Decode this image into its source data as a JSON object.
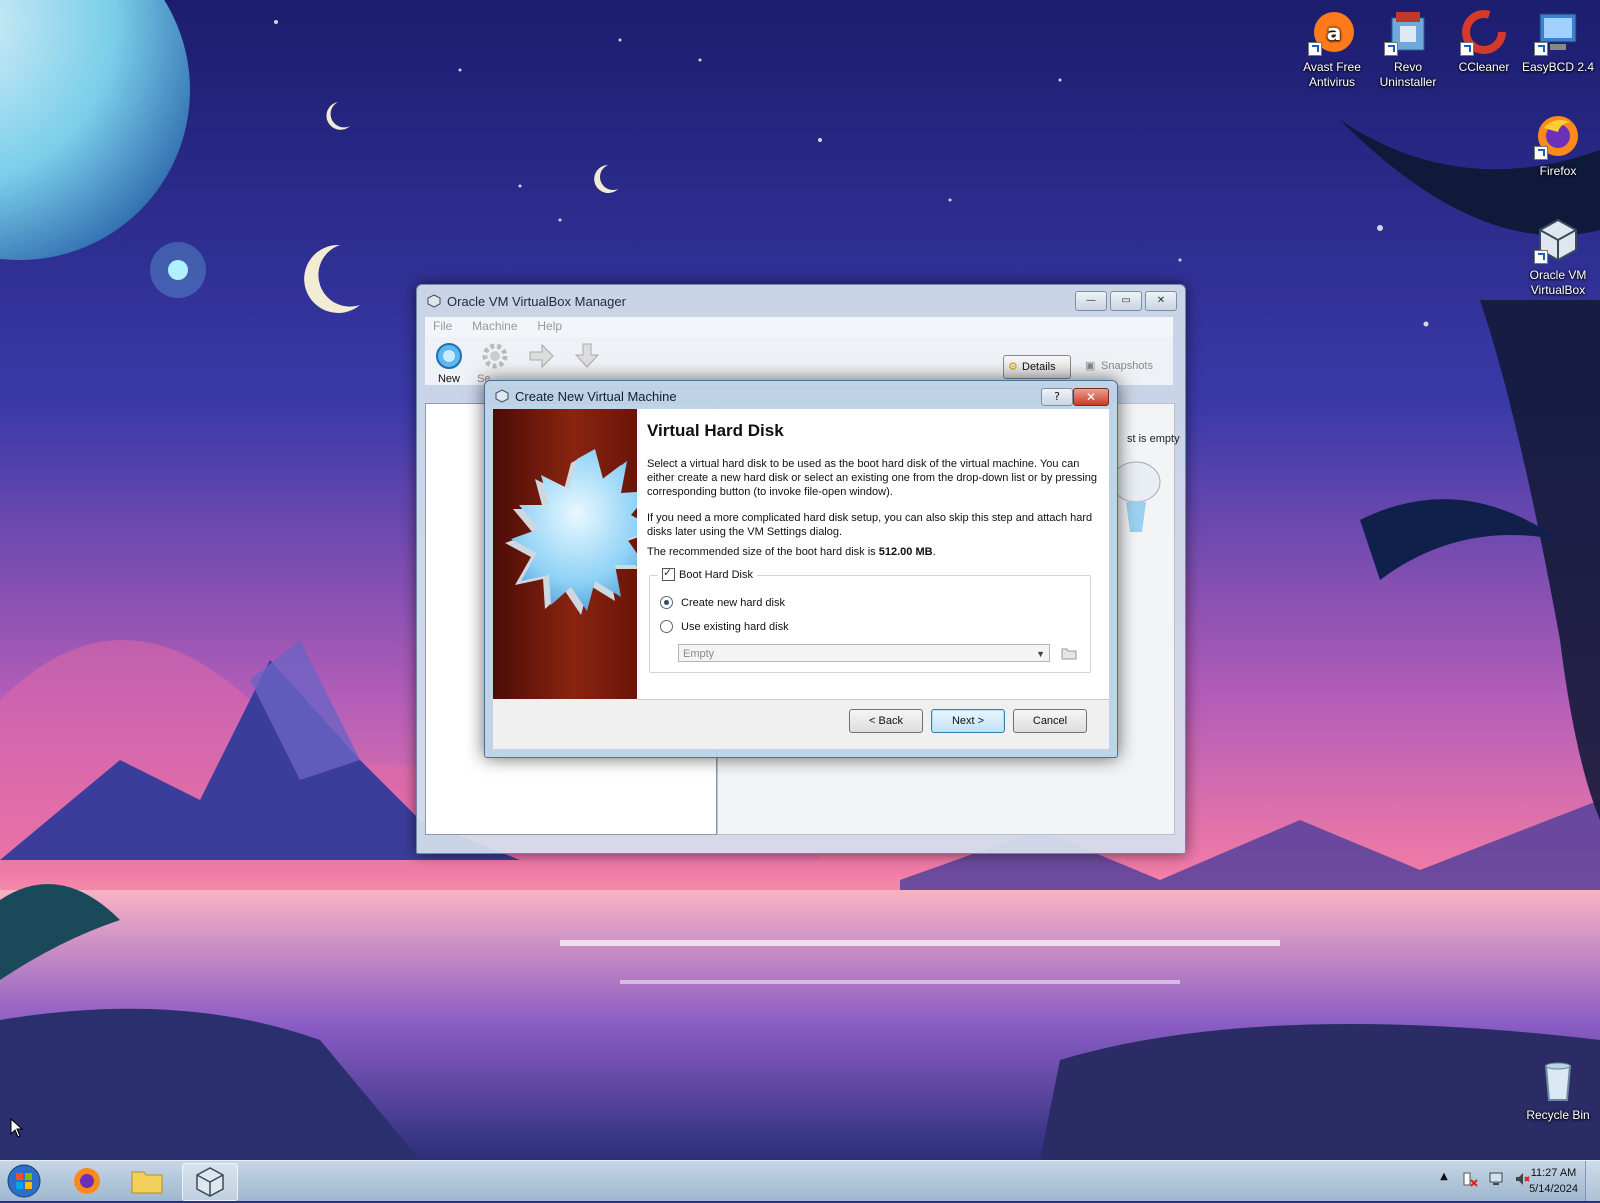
{
  "desktop": {
    "icons": [
      {
        "label": "Avast Free Antivirus"
      },
      {
        "label": "Revo Uninstaller"
      },
      {
        "label": "CCleaner"
      },
      {
        "label": "EasyBCD 2.4"
      },
      {
        "label": "Firefox"
      },
      {
        "label": "Oracle VM VirtualBox"
      },
      {
        "label": "Recycle Bin"
      }
    ]
  },
  "manager": {
    "title": "Oracle VM VirtualBox Manager",
    "menu": [
      "File",
      "Machine",
      "Help"
    ],
    "toolbar": {
      "new_label": "New",
      "settings_label": "Se"
    },
    "details_label": "Details",
    "snapshots_label": "Snapshots",
    "empty_note": "st is empty"
  },
  "wizard": {
    "title": "Create New Virtual Machine",
    "help_label": "?",
    "close_label": "✕",
    "heading": "Virtual Hard Disk",
    "para1": "Select a virtual hard disk to be used as the boot hard disk of the virtual machine. You can either create a new hard disk or select an existing one from the drop-down list or by pressing corresponding button (to invoke file-open window).",
    "para2": "If you need a more complicated hard disk setup, you can also skip this step and attach hard disks later using the VM Settings dialog.",
    "recommended_prefix": "The recommended size of the boot hard disk is",
    "recommended_size": "512.00 MB",
    "recommended_suffix": ".",
    "boot_hard_disk_label": "Boot Hard Disk",
    "create_new_label": "Create new hard disk",
    "use_existing_label": "Use existing hard disk",
    "existing_disk_value": "Empty",
    "back_label": "< Back",
    "next_label": "Next >",
    "cancel_label": "Cancel"
  },
  "taskbar": {
    "time": "11:27 AM",
    "date": "5/14/2024"
  }
}
